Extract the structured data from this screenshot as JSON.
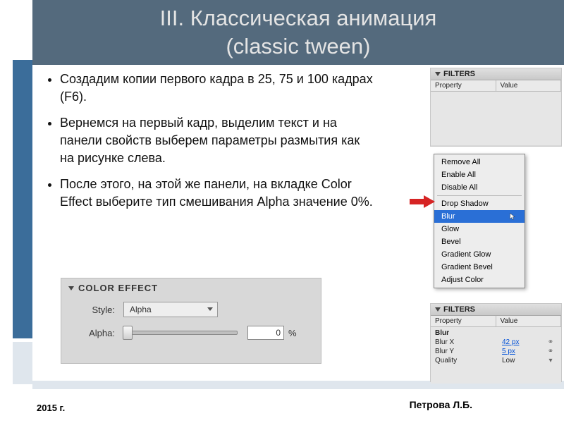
{
  "title_line1": "III. Классическая анимация",
  "title_line2": "(classic tween)",
  "bullets": [
    "Создадим копии первого кадра в 25, 75 и 100 кадрах (F6).",
    "Вернемся на первый кадр, выделим текст и на панели свойств выберем параметры размытия как на рисунке слева.",
    "После этого, на этой же панели, на вкладке Color Effect выберите тип смешивания Alpha значение  0%."
  ],
  "filters_panel": {
    "title": "FILTERS",
    "col_property": "Property",
    "col_value": "Value"
  },
  "context_menu": {
    "items_top": [
      "Remove All",
      "Enable All",
      "Disable All"
    ],
    "items_mid": [
      "Drop Shadow"
    ],
    "selected": "Blur",
    "items_bot": [
      "Glow",
      "Bevel",
      "Gradient Glow",
      "Gradient Bevel",
      "Adjust Color"
    ]
  },
  "filters_bottom": {
    "title": "FILTERS",
    "col_property": "Property",
    "col_value": "Value",
    "group": "Blur",
    "rows": [
      {
        "k": "Blur X",
        "v": "42 px",
        "link": true
      },
      {
        "k": "Blur Y",
        "v": "5 px",
        "link": true
      },
      {
        "k": "Quality",
        "v": "Low",
        "link": false
      }
    ]
  },
  "color_effect": {
    "title": "COLOR EFFECT",
    "style_label": "Style:",
    "style_value": "Alpha",
    "alpha_label": "Alpha:",
    "alpha_value": "0",
    "alpha_unit": "%"
  },
  "footer_year": "2015 г.",
  "footer_name": "Петрова Л.Б."
}
